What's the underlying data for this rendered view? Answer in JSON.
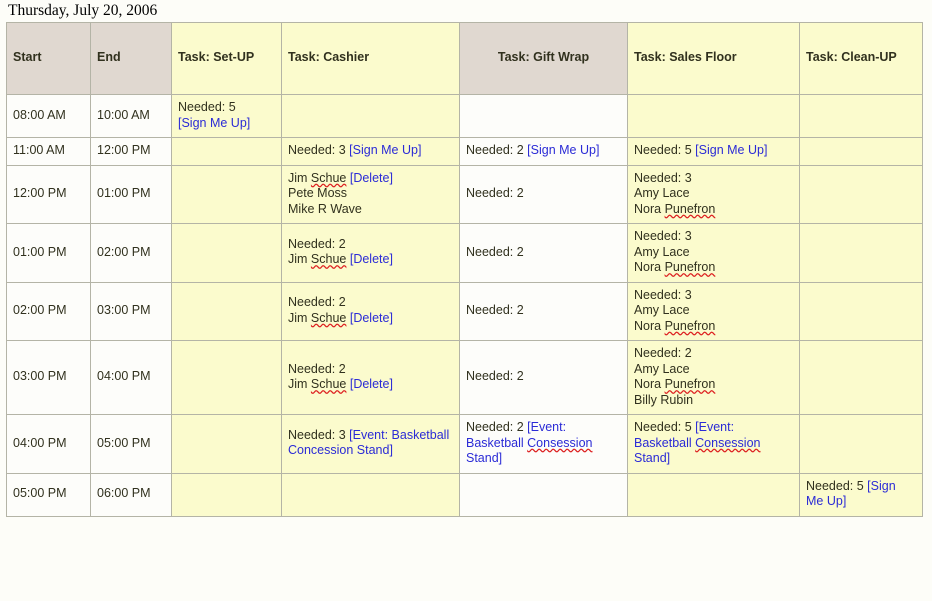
{
  "page": {
    "title": "Thursday, July 20, 2006"
  },
  "table": {
    "columns": [
      {
        "key": "start",
        "label": "Start",
        "style": "beige"
      },
      {
        "key": "end",
        "label": "End",
        "style": "beige"
      },
      {
        "key": "setup",
        "label": "Task: Set-UP",
        "style": "yellow"
      },
      {
        "key": "cash",
        "label": "Task: Cashier",
        "style": "yellow"
      },
      {
        "key": "gift",
        "label": "Task: Gift Wrap",
        "style": "beige"
      },
      {
        "key": "sales",
        "label": "Task: Sales Floor",
        "style": "yellow"
      },
      {
        "key": "clean",
        "label": "Task: Clean-UP",
        "style": "yellow"
      }
    ],
    "rows": [
      {
        "start": "08:00 AM",
        "end": "10:00 AM",
        "setup_needed": "Needed: 5",
        "setup_link": "[Sign Me Up]",
        "cash_text": "",
        "gift_text": "",
        "sales_text": "",
        "clean_text": ""
      },
      {
        "start": "11:00 AM",
        "end": "12:00 PM",
        "setup_text": "",
        "cash_needed": "Needed: 3",
        "cash_link": "[Sign Me Up]",
        "gift_needed": "Needed: 2",
        "gift_link": "[Sign Me Up]",
        "sales_needed": "Needed: 5",
        "sales_link": "[Sign Me Up]",
        "clean_text": ""
      },
      {
        "start": "12:00 PM",
        "end": "01:00 PM",
        "setup_text": "",
        "cash_name1": "Jim Schue",
        "cash_name1_misspelled": "Schue",
        "cash_link": "[Delete]",
        "cash_name2": "Pete Moss",
        "cash_name3": "Mike R Wave",
        "gift_needed": "Needed: 2",
        "sales_needed": "Needed: 3",
        "sales_name1": "Amy Lace",
        "sales_name2": "Nora Punefron",
        "clean_text": ""
      },
      {
        "start": "01:00 PM",
        "end": "02:00 PM",
        "setup_text": "",
        "cash_needed": "Needed: 2",
        "cash_name1": "Jim Schue",
        "cash_link": "[Delete]",
        "gift_needed": "Needed: 2",
        "sales_needed": "Needed: 3",
        "sales_name1": "Amy Lace",
        "sales_name2": "Nora Punefron",
        "clean_text": ""
      },
      {
        "start": "02:00 PM",
        "end": "03:00 PM",
        "setup_text": "",
        "cash_needed": "Needed: 2",
        "cash_name1": "Jim Schue",
        "cash_link": "[Delete]",
        "gift_needed": "Needed: 2",
        "sales_needed": "Needed: 3",
        "sales_name1": "Amy Lace",
        "sales_name2": "Nora Punefron",
        "clean_text": ""
      },
      {
        "start": "03:00 PM",
        "end": "04:00 PM",
        "setup_text": "",
        "cash_needed": "Needed: 2",
        "cash_name1": "Jim Schue",
        "cash_link": "[Delete]",
        "gift_needed": "Needed: 2",
        "sales_needed": "Needed: 2",
        "sales_name1": "Amy Lace",
        "sales_name2": "Nora Punefron",
        "sales_name3": "Billy Rubin",
        "clean_text": ""
      },
      {
        "start": "04:00 PM",
        "end": "05:00 PM",
        "setup_text": "",
        "cash_needed": "Needed: 3",
        "cash_event": "[Event: Basketball Concession Stand]",
        "gift_needed": "Needed: 2",
        "gift_event": "[Event: Basketball Consession Stand]",
        "sales_needed": "Needed: 5",
        "sales_event": "[Event: Basketball Consession Stand]",
        "clean_text": ""
      },
      {
        "start": "05:00 PM",
        "end": "06:00 PM",
        "setup_text": "",
        "cash_text": "",
        "gift_text": "",
        "sales_text": "",
        "clean_needed": "Needed: 5",
        "clean_link": "[Sign Me Up]"
      }
    ]
  },
  "colors": {
    "header_beige": "#e0d8d0",
    "cell_yellow": "#fbfbcd",
    "cell_white": "#fdfdfa",
    "link_blue": "#2b2bd6",
    "text": "#31311e",
    "border": "#b4b4a6",
    "spellcheck_red": "#dd2222"
  }
}
